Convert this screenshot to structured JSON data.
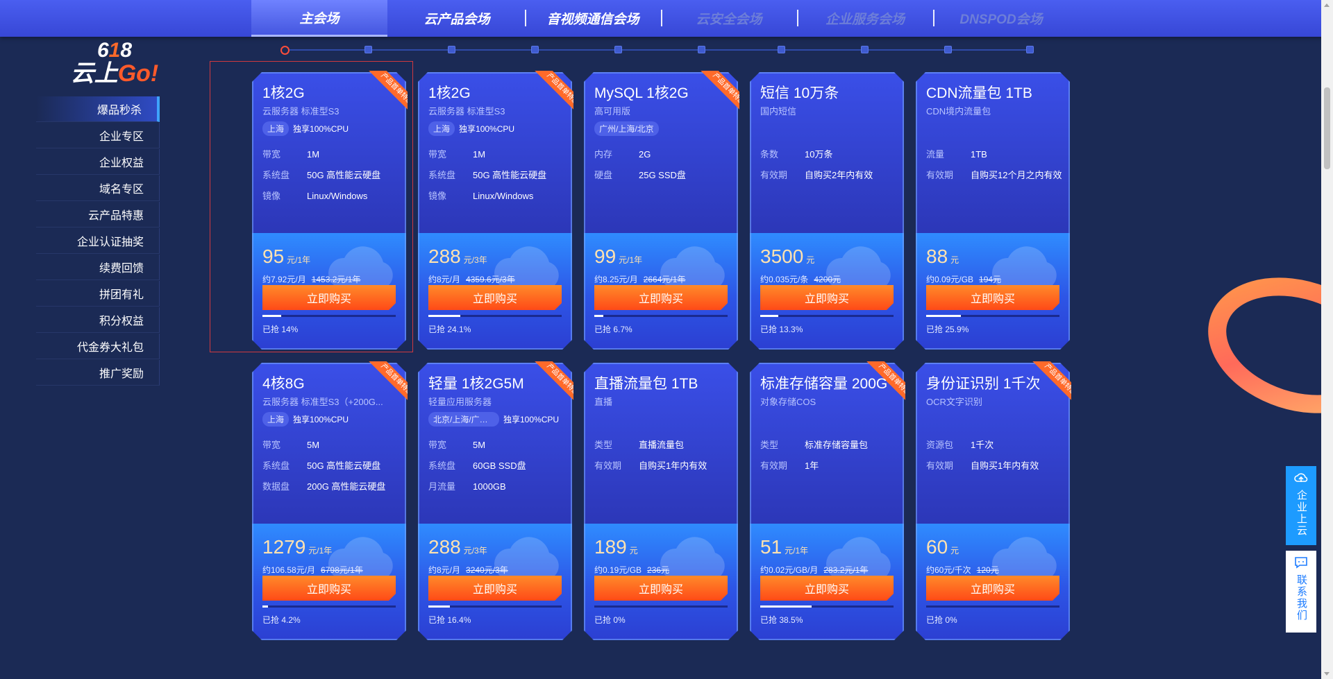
{
  "nav": {
    "tabs": [
      {
        "label": "主会场"
      },
      {
        "label": "云产品会场"
      },
      {
        "label": "音视频通信会场"
      },
      {
        "label": "云安全会场"
      },
      {
        "label": "企业服务会场"
      },
      {
        "label": "DNSPOD会场"
      }
    ]
  },
  "logo": {
    "l1_a": "6",
    "l1_b": "1",
    "l1_c": "8",
    "l2_a": "云上",
    "l2_b": "Go!"
  },
  "sidebar": {
    "items": [
      {
        "label": "爆品秒杀"
      },
      {
        "label": "企业专区"
      },
      {
        "label": "企业权益"
      },
      {
        "label": "域名专区"
      },
      {
        "label": "云产品特惠"
      },
      {
        "label": "企业认证抽奖"
      },
      {
        "label": "续费回馈"
      },
      {
        "label": "拼团有礼"
      },
      {
        "label": "积分权益"
      },
      {
        "label": "代金券大礼包"
      },
      {
        "label": "推广奖励"
      }
    ]
  },
  "ribbon_label": "产品首单特惠",
  "buy_label": "立即购买",
  "cards": [
    {
      "title": "1核2G",
      "sub": "云服务器 标准型S3",
      "tag": "上海",
      "tagtxt": "独享100%CPU",
      "specs": [
        {
          "k": "带宽",
          "v": "1M"
        },
        {
          "k": "系统盘",
          "v": "50G 高性能云硬盘"
        },
        {
          "k": "镜像",
          "v": "Linux/Windows"
        }
      ],
      "price": "95",
      "unit": "元/1年",
      "detail": "约7.92元/月",
      "orig": "1453.2元/1年",
      "sold": "已抢 14%",
      "progress": 0.14,
      "ribbon": true
    },
    {
      "title": "1核2G",
      "sub": "云服务器 标准型S3",
      "tag": "上海",
      "tagtxt": "独享100%CPU",
      "specs": [
        {
          "k": "带宽",
          "v": "1M"
        },
        {
          "k": "系统盘",
          "v": "50G 高性能云硬盘"
        },
        {
          "k": "镜像",
          "v": "Linux/Windows"
        }
      ],
      "price": "288",
      "unit": "元/3年",
      "detail": "约8元/月",
      "orig": "4359.6元/3年",
      "sold": "已抢 24.1%",
      "progress": 0.241,
      "ribbon": true
    },
    {
      "title": "MySQL 1核2G",
      "sub": "高可用版",
      "tag": "广州/上海/北京",
      "tagtxt": "",
      "specs": [
        {
          "k": "内存",
          "v": "2G"
        },
        {
          "k": "硬盘",
          "v": "25G SSD盘"
        }
      ],
      "price": "99",
      "unit": "元/1年",
      "detail": "约8.25元/月",
      "orig": "2664元/1年",
      "sold": "已抢 6.7%",
      "progress": 0.067,
      "ribbon": true
    },
    {
      "title": "短信 10万条",
      "sub": "国内短信",
      "tag": "",
      "tagtxt": "",
      "specs": [
        {
          "k": "条数",
          "v": "10万条"
        },
        {
          "k": "有效期",
          "v": "自购买2年内有效"
        }
      ],
      "price": "3500",
      "unit": "元",
      "detail": "约0.035元/条",
      "orig": "4200元",
      "sold": "已抢 13.3%",
      "progress": 0.133,
      "ribbon": false
    },
    {
      "title": "CDN流量包 1TB",
      "sub": "CDN境内流量包",
      "tag": "",
      "tagtxt": "",
      "specs": [
        {
          "k": "流量",
          "v": "1TB"
        },
        {
          "k": "有效期",
          "v": "自购买12个月之内有效"
        }
      ],
      "price": "88",
      "unit": "元",
      "detail": "约0.09元/GB",
      "orig": "194元",
      "sold": "已抢 25.9%",
      "progress": 0.259,
      "ribbon": false
    },
    {
      "title": "4核8G",
      "sub": "云服务器 标准型S3（+200G...",
      "tag": "上海",
      "tagtxt": "独享100%CPU",
      "specs": [
        {
          "k": "带宽",
          "v": "5M"
        },
        {
          "k": "系统盘",
          "v": "50G 高性能云硬盘"
        },
        {
          "k": "数据盘",
          "v": "200G 高性能云硬盘"
        }
      ],
      "price": "1279",
      "unit": "元/1年",
      "detail": "约106.58元/月",
      "orig": "6798元/1年",
      "sold": "已抢 4.2%",
      "progress": 0.042,
      "ribbon": true
    },
    {
      "title": "轻量 1核2G5M",
      "sub": "轻量应用服务器",
      "tag": "北京/上海/广州...",
      "tagtxt": "独享100%CPU",
      "specs": [
        {
          "k": "带宽",
          "v": "5M"
        },
        {
          "k": "系统盘",
          "v": "60GB SSD盘"
        },
        {
          "k": "月流量",
          "v": "1000GB"
        }
      ],
      "price": "288",
      "unit": "元/3年",
      "detail": "约8元/月",
      "orig": "3240元/3年",
      "sold": "已抢 16.4%",
      "progress": 0.164,
      "ribbon": true
    },
    {
      "title": "直播流量包 1TB",
      "sub": "直播",
      "tag": "",
      "tagtxt": "",
      "specs": [
        {
          "k": "类型",
          "v": "直播流量包"
        },
        {
          "k": "有效期",
          "v": "自购买1年内有效"
        }
      ],
      "price": "189",
      "unit": "元",
      "detail": "约0.19元/GB",
      "orig": "236元",
      "sold": "已抢 0%",
      "progress": 0,
      "ribbon": false
    },
    {
      "title": "标准存储容量 200G",
      "sub": "对象存储COS",
      "tag": "",
      "tagtxt": "",
      "specs": [
        {
          "k": "类型",
          "v": "标准存储容量包"
        },
        {
          "k": "有效期",
          "v": "1年"
        }
      ],
      "price": "51",
      "unit": "元/1年",
      "detail": "约0.02元/GB/月",
      "orig": "283.2元/1年",
      "sold": "已抢 38.5%",
      "progress": 0.385,
      "ribbon": true
    },
    {
      "title": "身份证识别 1千次",
      "sub": "OCR文字识别",
      "tag": "",
      "tagtxt": "",
      "specs": [
        {
          "k": "资源包",
          "v": "1千次"
        },
        {
          "k": "有效期",
          "v": "自购买1年内有效"
        }
      ],
      "price": "60",
      "unit": "元",
      "detail": "约60元/千次",
      "orig": "120元",
      "sold": "已抢 0%",
      "progress": 0,
      "ribbon": true
    }
  ],
  "float": {
    "cloud": "企业上云",
    "contact": "联系我们"
  },
  "colors": {
    "accent": "#ff5a1f",
    "brand": "#3a4fe8",
    "price": "#ffe2b0"
  }
}
